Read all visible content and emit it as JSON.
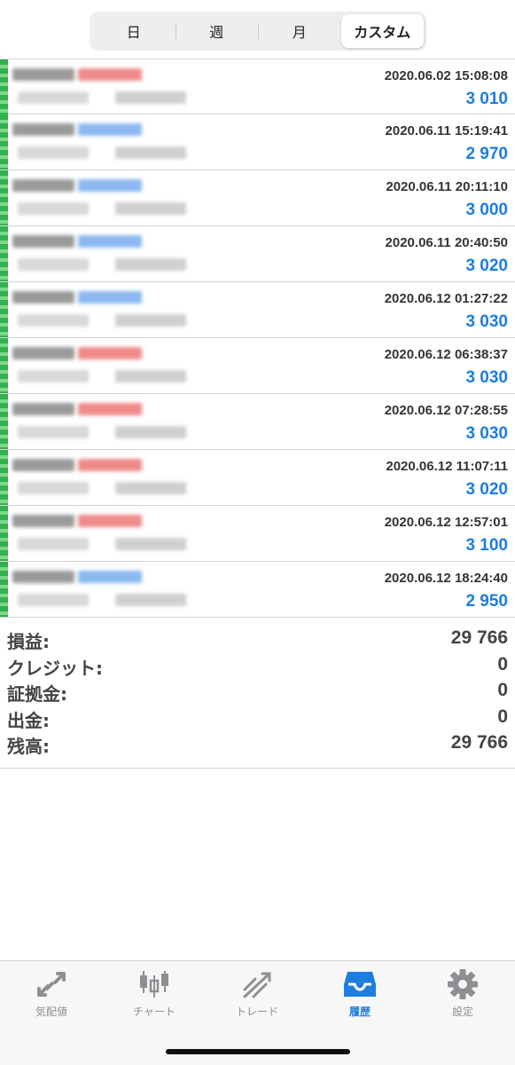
{
  "segments": [
    {
      "label": "日",
      "active": false
    },
    {
      "label": "週",
      "active": false
    },
    {
      "label": "月",
      "active": false
    },
    {
      "label": "カスタム",
      "active": true
    }
  ],
  "rows": [
    {
      "datetime": "2020.06.02 15:08:08",
      "value": "3 010",
      "type_color": "#f08a8a"
    },
    {
      "datetime": "2020.06.11 15:19:41",
      "value": "2 970",
      "type_color": "#8ab8f0"
    },
    {
      "datetime": "2020.06.11 20:11:10",
      "value": "3 000",
      "type_color": "#8ab8f0"
    },
    {
      "datetime": "2020.06.11 20:40:50",
      "value": "3 020",
      "type_color": "#8ab8f0"
    },
    {
      "datetime": "2020.06.12 01:27:22",
      "value": "3 030",
      "type_color": "#8ab8f0"
    },
    {
      "datetime": "2020.06.12 06:38:37",
      "value": "3 030",
      "type_color": "#f08a8a"
    },
    {
      "datetime": "2020.06.12 07:28:55",
      "value": "3 030",
      "type_color": "#f08a8a"
    },
    {
      "datetime": "2020.06.12 11:07:11",
      "value": "3 020",
      "type_color": "#f08a8a"
    },
    {
      "datetime": "2020.06.12 12:57:01",
      "value": "3 100",
      "type_color": "#f08a8a"
    },
    {
      "datetime": "2020.06.12 18:24:40",
      "value": "2 950",
      "type_color": "#8ab8f0"
    }
  ],
  "summary": [
    {
      "label": "損益:",
      "value": "29 766"
    },
    {
      "label": "クレジット:",
      "value": "0"
    },
    {
      "label": "証拠金:",
      "value": "0"
    },
    {
      "label": "出金:",
      "value": "0"
    },
    {
      "label": "残高:",
      "value": "29 766"
    }
  ],
  "tabs": [
    {
      "label": "気配値",
      "icon": "quotes-icon",
      "active": false
    },
    {
      "label": "チャート",
      "icon": "chart-icon",
      "active": false
    },
    {
      "label": "トレード",
      "icon": "trade-icon",
      "active": false
    },
    {
      "label": "履歴",
      "icon": "history-icon",
      "active": true
    },
    {
      "label": "設定",
      "icon": "settings-icon",
      "active": false
    }
  ],
  "colors": {
    "accent": "#1e7de0",
    "inactive": "#8e8e93",
    "buy_edge": "#2fb24a"
  }
}
